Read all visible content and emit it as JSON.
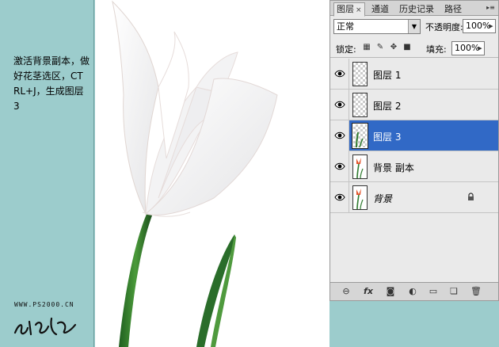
{
  "instruction_text": "激活背景副本，做好花茎选区，CTRL+J，生成图层3",
  "watermark": "WWW.PS2000.CN",
  "tabs": [
    {
      "label": "图层",
      "active": true
    },
    {
      "label": "通道",
      "active": false
    },
    {
      "label": "历史记录",
      "active": false
    },
    {
      "label": "路径",
      "active": false
    }
  ],
  "tab_close": "×",
  "panel_menu_icon": "menu-arrow-icon",
  "blend_mode": "正常",
  "opacity_label": "不透明度:",
  "opacity_value": "100%",
  "lock_label": "锁定:",
  "fill_label": "填充:",
  "fill_value": "100%",
  "layers": [
    {
      "name": "图层 1",
      "thumb": "transparent",
      "selected": false,
      "italic": false,
      "locked": false
    },
    {
      "name": "图层 2",
      "thumb": "transparent",
      "selected": false,
      "italic": false,
      "locked": false
    },
    {
      "name": "图层 3",
      "thumb": "stem",
      "selected": true,
      "italic": false,
      "locked": false
    },
    {
      "name": "背景 副本",
      "thumb": "photo",
      "selected": false,
      "italic": false,
      "locked": false
    },
    {
      "name": "背景",
      "thumb": "photo",
      "selected": false,
      "italic": true,
      "locked": true
    }
  ],
  "colors": {
    "background": "#9ccccc",
    "panel": "#eaeaea",
    "selection": "#3169c6",
    "stem": "#2e7a2e"
  }
}
